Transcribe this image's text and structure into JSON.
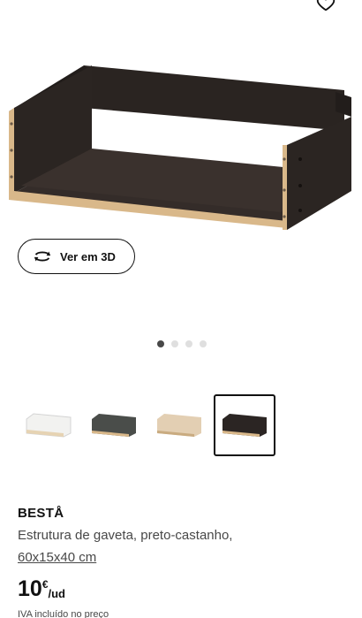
{
  "header": {
    "favorite_icon": "heart-icon"
  },
  "hero": {
    "image_alt": "drawer-frame-black-brown"
  },
  "view3d": {
    "label": "Ver em 3D",
    "icon": "rotate-3d-icon"
  },
  "carousel": {
    "count": 4,
    "active_index": 0
  },
  "variants": [
    {
      "name": "white",
      "color": "#f2f2f0",
      "selected": false
    },
    {
      "name": "dark-grey",
      "color": "#4a4d4a",
      "selected": false
    },
    {
      "name": "white-stained-oak",
      "color": "#e3cfb3",
      "selected": false
    },
    {
      "name": "black-brown",
      "color": "#2b2523",
      "selected": true
    }
  ],
  "product": {
    "name": "BESTÅ",
    "description": "Estrutura de gaveta, preto-castanho,",
    "size": "60x15x40 cm",
    "price": "10",
    "currency": "€",
    "unit": "/ud",
    "vat_note": "IVA incluído no preço"
  },
  "colors": {
    "accent": "#111111",
    "muted": "#484848",
    "dot_inactive": "#dfdfdf",
    "edge_wood": "#d9b88a"
  }
}
